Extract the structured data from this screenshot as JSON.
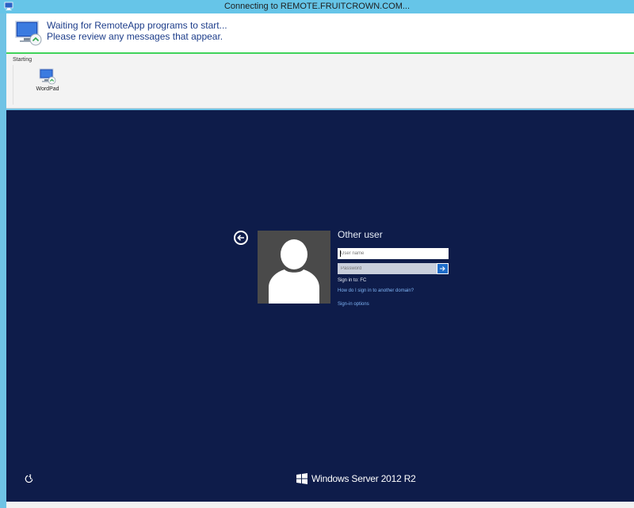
{
  "window": {
    "title": "Connecting to REMOTE.FRUITCROWN.COM...",
    "icon": "remote-desktop-icon"
  },
  "banner": {
    "line1": "Waiting for RemoteApp programs to start...",
    "line2": "Please review any messages that appear.",
    "icon": "remote-app-icon"
  },
  "progress": {
    "section_label": "Starting",
    "apps": [
      {
        "label": "WordPad",
        "icon": "remote-app-icon"
      }
    ]
  },
  "login": {
    "user_heading": "Other user",
    "username_placeholder": "User name",
    "password_placeholder": "Password",
    "sign_in_to": "Sign in to: FC",
    "link_other_domain": "How do I sign in to another domain?",
    "link_sign_in_options": "Sign-in options"
  },
  "footer": {
    "brand": "Windows Server 2012 R2",
    "icons": [
      "ease-of-access-icon",
      "windows-logo-icon"
    ]
  },
  "colors": {
    "titlebar": "#66c5e8",
    "remote_background": "#0e1c4a",
    "banner_text": "#1d3d8a",
    "accent_green": "#3fd35a",
    "submit_blue": "#1e6cc9",
    "link": "#7fb4f5"
  }
}
